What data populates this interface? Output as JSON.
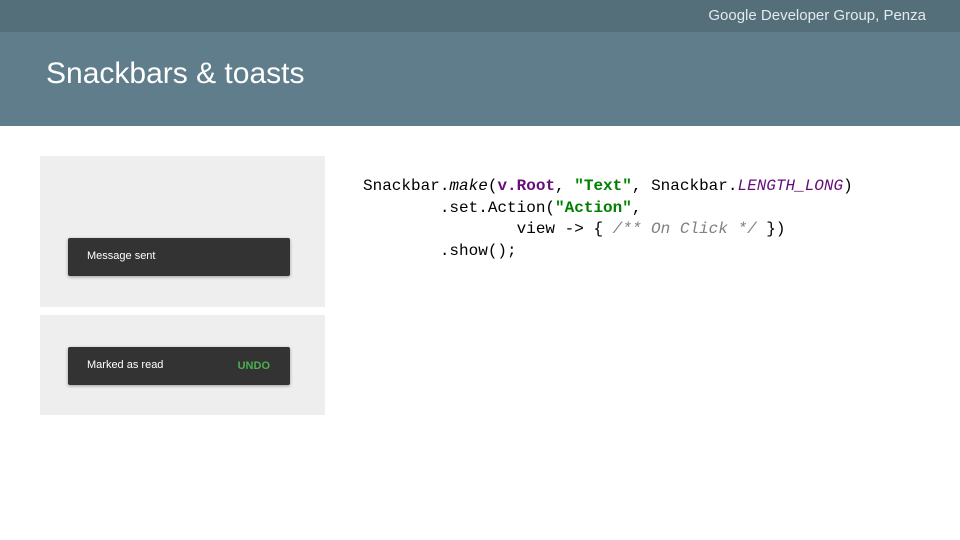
{
  "header": {
    "organization": "Google Developer Group, Penza",
    "title": "Snackbars & toasts"
  },
  "demos": [
    {
      "message": "Message sent",
      "action": ""
    },
    {
      "message": "Marked as read",
      "action": "UNDO"
    }
  ],
  "code": {
    "line1": {
      "obj": "Snackbar.",
      "method": "make",
      "open": "(",
      "arg1": "v.Root",
      "sep1": ", ",
      "str1": "\"Text\"",
      "sep2": ", Snackbar.",
      "const": "LENGTH_LONG",
      "close": ")"
    },
    "line2": {
      "indent": "        ",
      "call": ".set.Action(",
      "str": "\"Action\"",
      "end": ","
    },
    "line3": {
      "indent": "                ",
      "lambda": "view -> { ",
      "comment": "/** On Click */",
      "end": " })"
    },
    "line4": {
      "indent": "        ",
      "call": ".show();"
    }
  },
  "colors": {
    "topbar": "#546e7a",
    "header": "#607d8b",
    "demo_bg": "#eeeeee",
    "snackbar": "#333333",
    "action": "#4caf50"
  }
}
